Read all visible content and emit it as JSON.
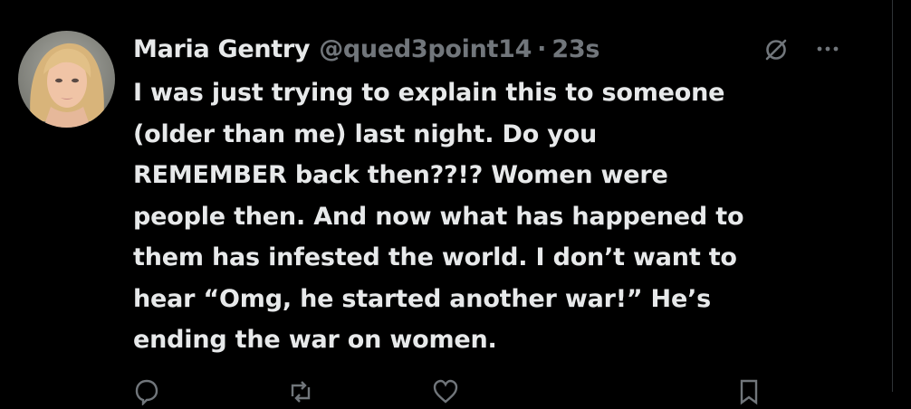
{
  "tweet": {
    "author_name": "Maria Gentry",
    "author_handle": "@qued3point14",
    "separator": "·",
    "timestamp": "23s",
    "text": "I was just trying to explain this to someone\n(older than me) last night. Do you\nREMEMBER back then??!?  Women were\npeople then. And now what has happened to\nthem has infested the world. I don’t want to\nhear “Omg, he started another war!” He’s\nending the war on women."
  },
  "icons": {
    "avatar": "profile-photo",
    "grok": "grok-icon",
    "more": "more-icon",
    "reply": "reply-icon",
    "repost": "repost-icon",
    "like": "like-icon",
    "bookmark": "bookmark-icon"
  },
  "colors": {
    "background": "#000000",
    "text_primary": "#e7e9ea",
    "text_secondary": "#71767b",
    "divider": "#2f3336"
  }
}
